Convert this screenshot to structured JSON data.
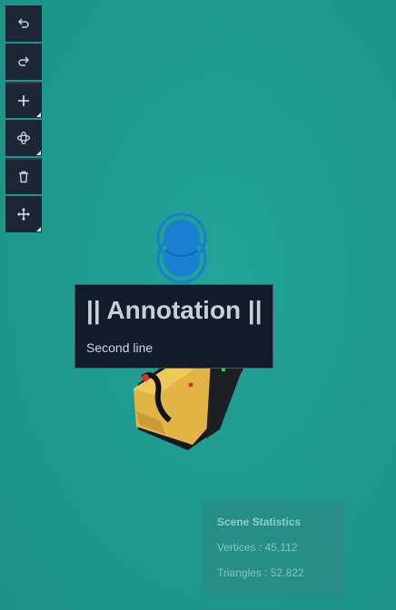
{
  "toolbar": {
    "tools": [
      {
        "name": "undo",
        "icon": "undo-icon"
      },
      {
        "name": "redo",
        "icon": "redo-icon"
      },
      {
        "name": "add",
        "icon": "plus-icon"
      },
      {
        "name": "orbit",
        "icon": "orbit-icon"
      },
      {
        "name": "delete",
        "icon": "trash-icon"
      },
      {
        "name": "move",
        "icon": "move-arrows-icon"
      }
    ]
  },
  "annotation": {
    "title": "|| Annotation ||",
    "body": "Second line"
  },
  "stats": {
    "heading": "Scene Statistics",
    "vertices": "Vertices : 45,112",
    "triangles": "Triangles : 52,822"
  },
  "colors": {
    "background": "#1f9a8f",
    "toolbar": "#1c2636",
    "marker": "#1a7fd0",
    "annotation_bg": "#111b2a"
  }
}
